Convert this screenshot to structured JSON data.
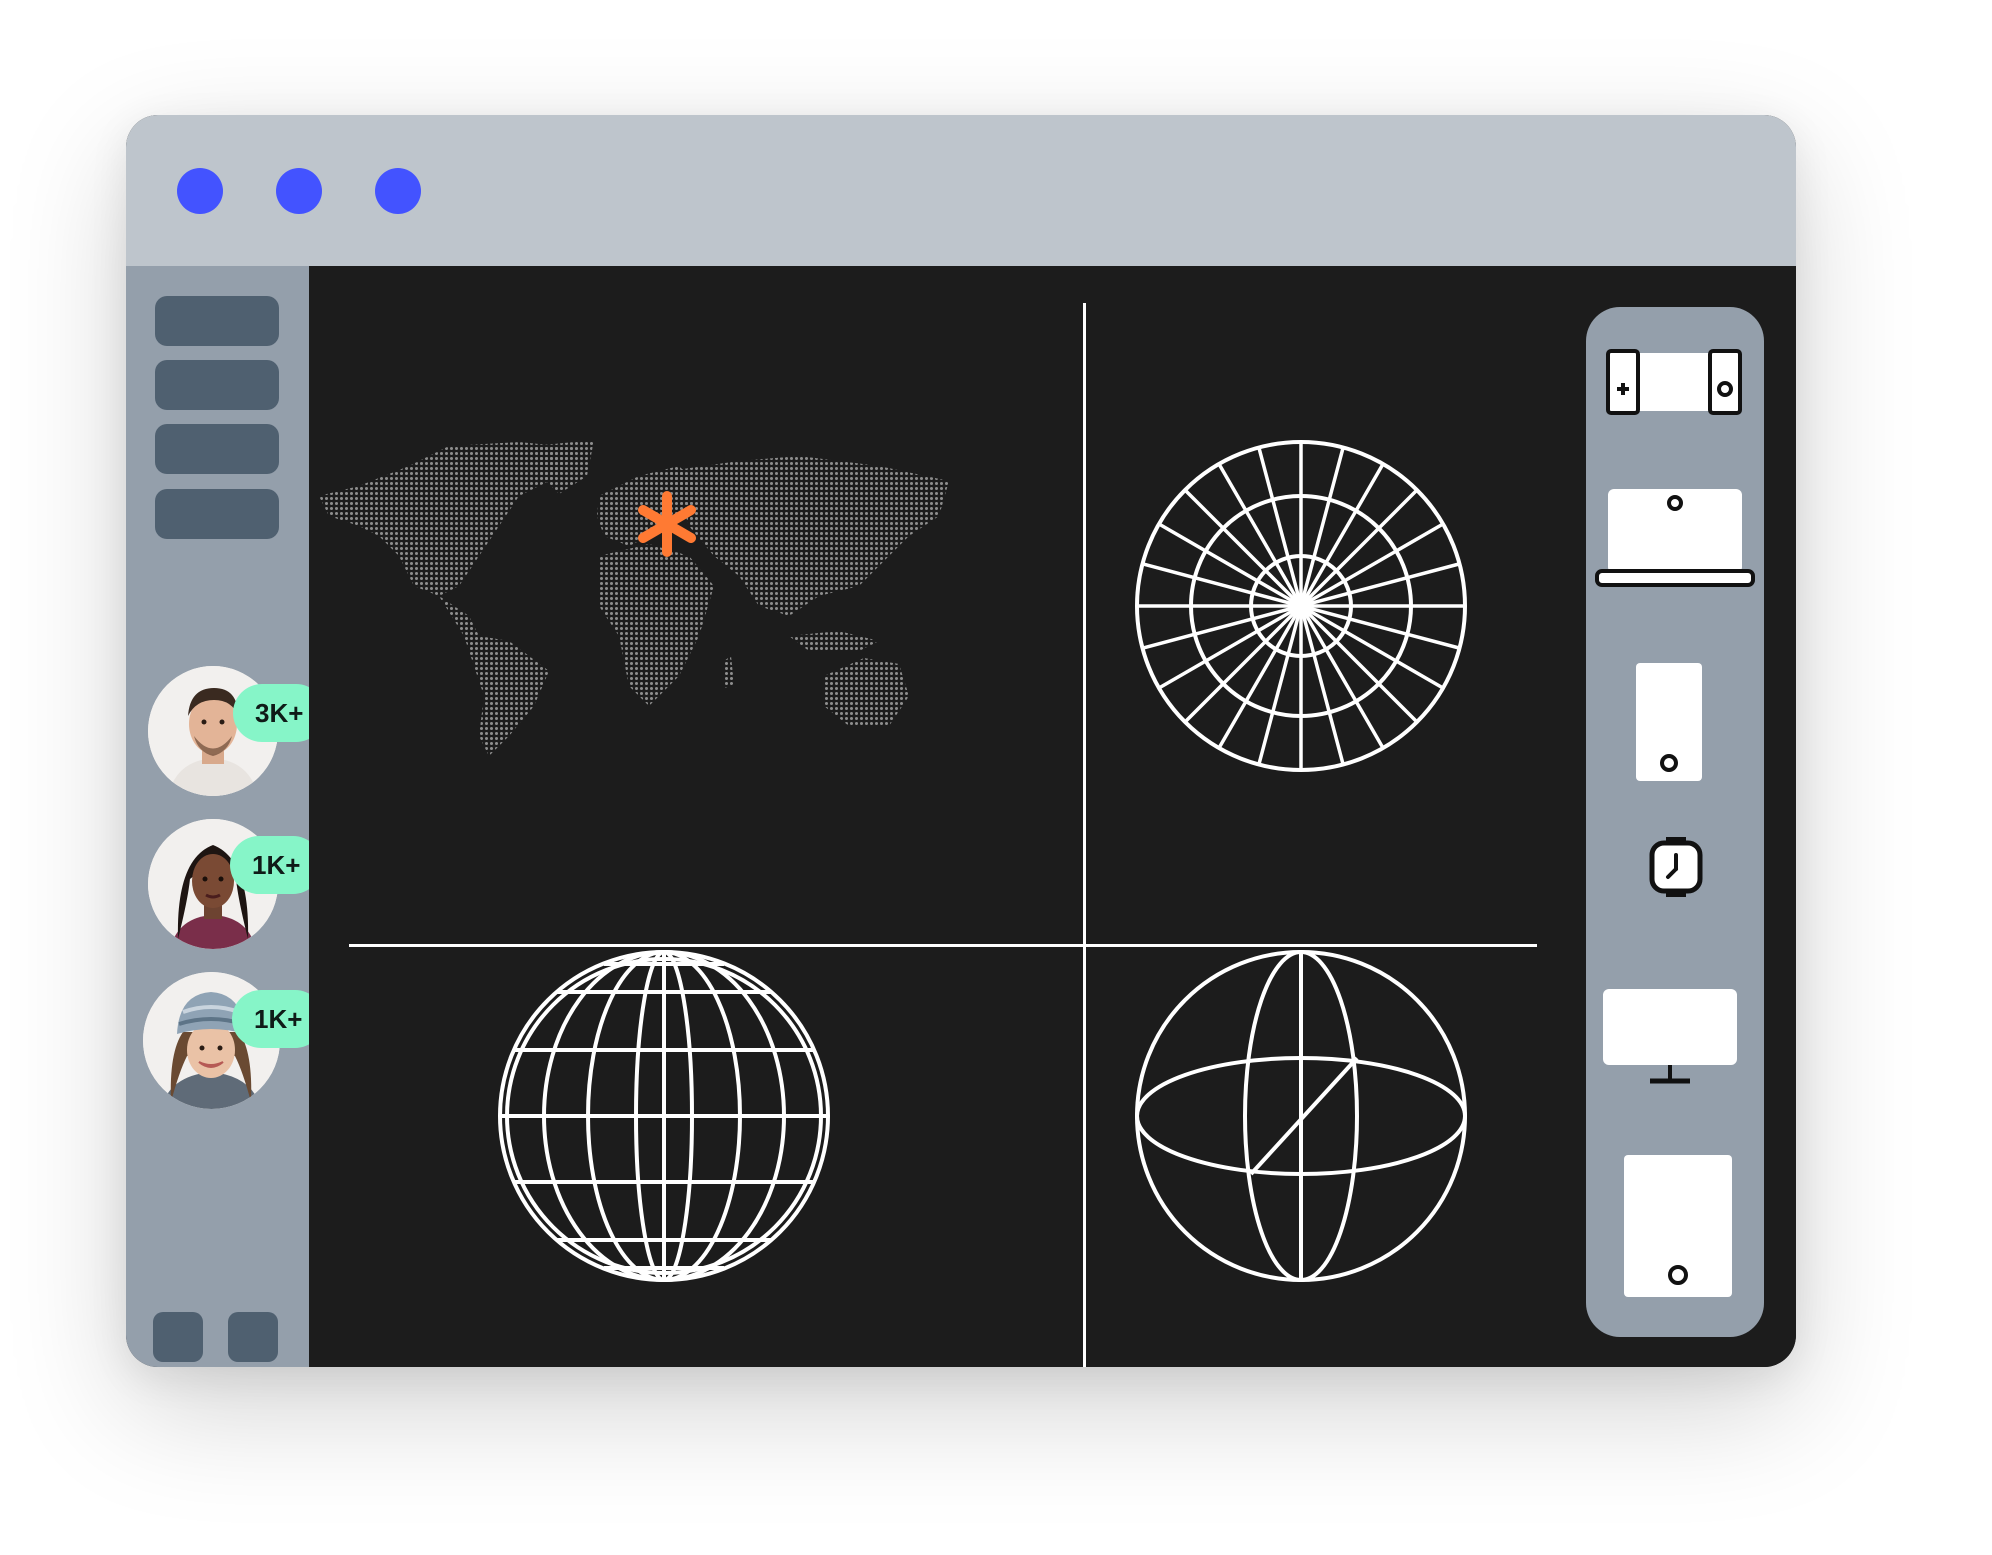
{
  "window": {
    "accent": "#4353ff",
    "titlebar_color": "#bec5cc",
    "sidebar_color": "#949fab",
    "canvas_color": "#1c1c1c"
  },
  "users": [
    {
      "badge": "3K+"
    },
    {
      "badge": "1K+"
    },
    {
      "badge": "1K+"
    }
  ],
  "panels": [
    {
      "icon": "world-map-icon",
      "marker": "asterisk-marker-icon",
      "marker_color": "#ff7a33"
    },
    {
      "icon": "polar-grid-globe-icon"
    },
    {
      "icon": "latitude-longitude-globe-icon"
    },
    {
      "icon": "wireframe-sphere-icon"
    }
  ],
  "devices": [
    "game-console-icon",
    "laptop-icon",
    "phone-icon",
    "smartwatch-icon",
    "monitor-icon",
    "tablet-icon"
  ],
  "badge_color": "#86f5c8"
}
